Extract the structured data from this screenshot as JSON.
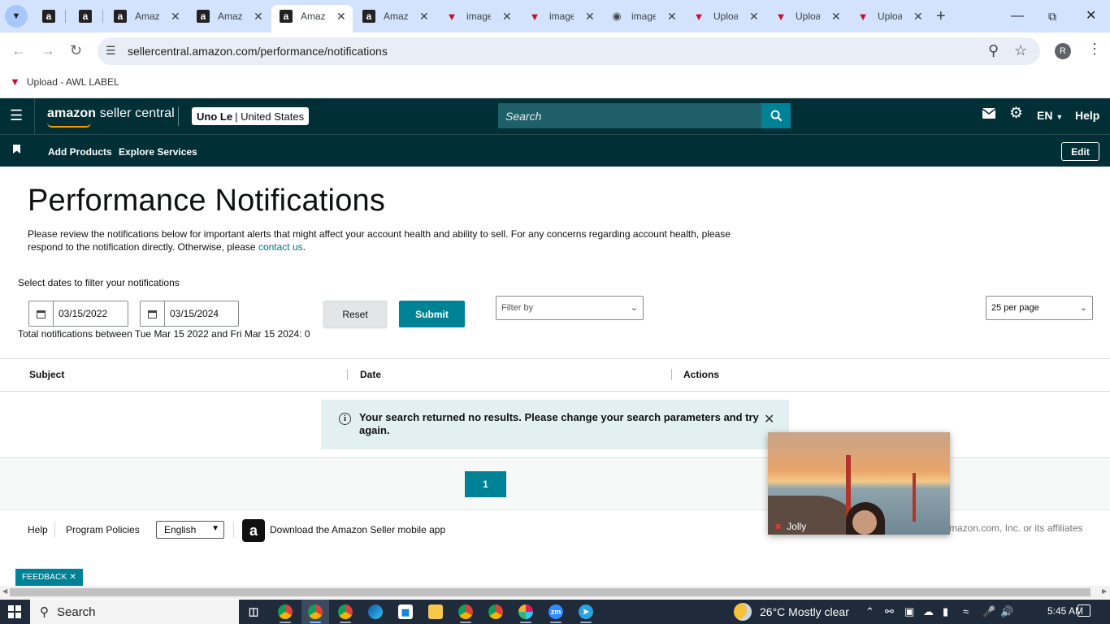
{
  "browser": {
    "tabs": [
      {
        "title": "",
        "icon": "amazon-icon",
        "active": false
      },
      {
        "title": "",
        "icon": "amazon-icon",
        "active": false
      },
      {
        "title": "Amaz",
        "icon": "amazon-icon",
        "active": false
      },
      {
        "title": "Amaz",
        "icon": "amazon-icon",
        "active": false
      },
      {
        "title": "Amaz",
        "icon": "amazon-icon",
        "active": true
      },
      {
        "title": "Amaz",
        "icon": "amazon-icon",
        "active": false
      },
      {
        "title": "image",
        "icon": "vendor-logo-icon",
        "active": false
      },
      {
        "title": "image",
        "icon": "vendor-logo-icon",
        "active": false
      },
      {
        "title": "image",
        "icon": "generic-site-icon",
        "active": false
      },
      {
        "title": "Uploa",
        "icon": "vendor-logo-icon",
        "active": false
      },
      {
        "title": "Uploa",
        "icon": "vendor-logo-icon",
        "active": false
      },
      {
        "title": "Uploa",
        "icon": "vendor-logo-icon",
        "active": false
      }
    ],
    "url": "sellercentral.amazon.com/performance/notifications",
    "profile_initial": "R",
    "bookmark": "Upload - AWL LABEL"
  },
  "header": {
    "logo_bold": "amazon",
    "logo_rest": " seller central",
    "account_name": "Uno Le",
    "account_region": "United States",
    "search_placeholder": "Search",
    "language": "EN",
    "help": "Help"
  },
  "nav": {
    "links": [
      "Add Products",
      "Explore Services"
    ],
    "edit": "Edit"
  },
  "main": {
    "title": "Performance Notifications",
    "intro_text": "Please review the notifications below for important alerts that might affect your account health and ability to sell. For any concerns regarding account health, please respond to the notification directly. Otherwise, please ",
    "intro_link": "contact us",
    "intro_end": ".",
    "date_label": "Select dates to filter your notifications",
    "start_date": "03/15/2022",
    "end_date": "03/15/2024",
    "reset": "Reset",
    "submit": "Submit",
    "filter_placeholder": "Filter by",
    "per_page": "25 per page",
    "total": "Total notifications between Tue Mar 15 2022 and Fri Mar 15 2024: 0"
  },
  "table": {
    "columns": [
      "Subject",
      "Date",
      "Actions"
    ],
    "empty_message": "Your search returned no results. Please change your search parameters and try again."
  },
  "pagination": {
    "current_page": "1"
  },
  "footer": {
    "help": "Help",
    "program_policies": "Program Policies",
    "language": "English",
    "app_text": "Download the Amazon Seller mobile app",
    "copyright": "mazon.com, Inc. or its affiliates"
  },
  "feedback": "FEEDBACK",
  "video": {
    "participant": "Jolly"
  },
  "taskbar": {
    "search": "Search",
    "weather": "26°C  Mostly clear",
    "time": "5:45 AM"
  },
  "colors": {
    "header_bg": "#002f36",
    "accent_teal": "#008296",
    "link": "#007185",
    "alert_bg": "#e3f0f1"
  }
}
